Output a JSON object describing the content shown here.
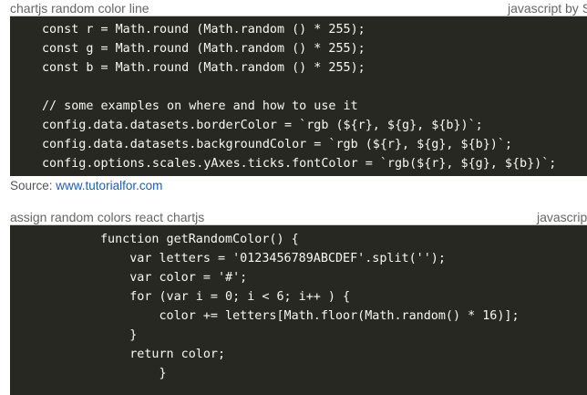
{
  "snippet1": {
    "title": "chartjs random color line",
    "language": "javascript by S",
    "lines": [
      "const r = Math.round (Math.random () * 255);",
      "const g = Math.round (Math.random () * 255);",
      "const b = Math.round (Math.random () * 255);",
      "",
      "// some examples on where and how to use it",
      "config.data.datasets.borderColor = `rgb (${r}, ${g}, ${b})`;",
      "config.data.datasets.backgroundColor = `rgb (${r}, ${g}, ${b})`;",
      "config.options.scales.yAxes.ticks.fontColor = `rgb(${r}, ${g}, ${b})`;"
    ],
    "source_label": "Source:",
    "source_link": "www.tutorialfor.com"
  },
  "snippet2": {
    "title": "assign random colors react chartjs",
    "language": "javascript",
    "lines": [
      "function getRandomColor() {",
      "    var letters = '0123456789ABCDEF'.split('');",
      "    var color = '#';",
      "    for (var i = 0; i < 6; i++ ) {",
      "        color += letters[Math.floor(Math.random() * 16)];",
      "    }",
      "    return color;",
      "        }"
    ]
  },
  "colors": {
    "code_background": "#272822",
    "code_text": "#f8f8f2",
    "link": "#1f5fb0"
  }
}
